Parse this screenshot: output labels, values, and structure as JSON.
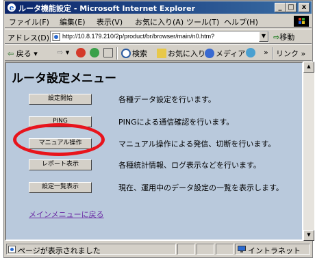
{
  "window": {
    "title": "ルータ機能設定 - Microsoft Internet Explorer",
    "minimize": "_",
    "maximize": "□",
    "close": "x"
  },
  "menubar": {
    "items": [
      "ファイル(F)",
      "編集(E)",
      "表示(V)",
      "お気に入り(A)",
      "ツール(T)",
      "ヘルプ(H)"
    ]
  },
  "address": {
    "label": "アドレス(D)",
    "url": "http://10.8.179.210/2p/product/br/browser/main/n0.htm?",
    "go": "移動"
  },
  "toolbar": {
    "back": "戻る",
    "search": "検索",
    "favorites": "お気に入り",
    "media": "メディア",
    "links": "リンク",
    "more": "»"
  },
  "page": {
    "title": "ルータ設定メニュー",
    "actions": [
      {
        "button": "設定開始",
        "description": "各種データ設定を行います。"
      },
      {
        "button": "PING",
        "description": "PINGによる通信確認を行います。"
      },
      {
        "button": "マニュアル操作",
        "description": "マニュアル操作による発信、切断を行います。"
      },
      {
        "button": "レポート表示",
        "description": "各種統計情報、ログ表示などを行います。"
      },
      {
        "button": "設定一覧表示",
        "description": "現在、運用中のデータ設定の一覧を表示します。"
      }
    ],
    "main_menu_link": "メインメニューに戻る"
  },
  "statusbar": {
    "text": "ページが表示されました",
    "zone": "イントラネット"
  },
  "colors": {
    "content_bg": "#b9c9dc",
    "highlight": "#e8141c",
    "title_bar": "#0a246a"
  }
}
